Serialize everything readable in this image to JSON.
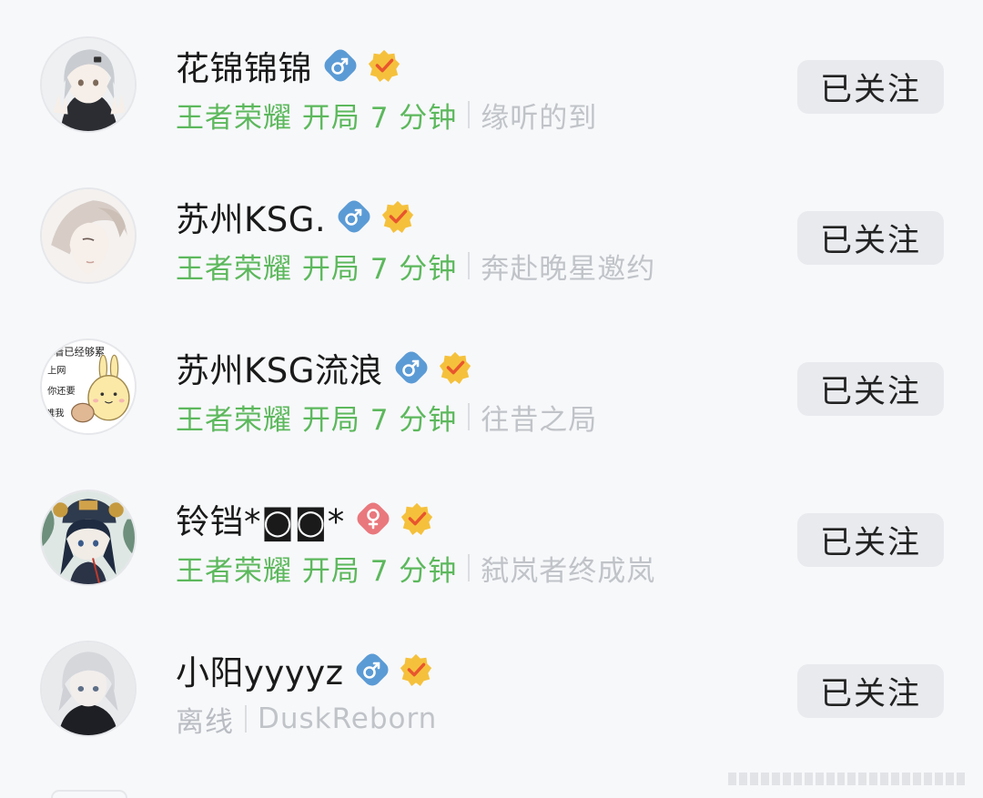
{
  "friends": [
    {
      "name": "花锦锦锦",
      "gender": "male",
      "status": "王者荣耀 开局 7 分钟",
      "status_kind": "in-game",
      "signature": "缘听的到",
      "follow_label": "已关注"
    },
    {
      "name": "苏州KSG.",
      "gender": "male",
      "status": "王者荣耀 开局 7 分钟",
      "status_kind": "in-game",
      "signature": "奔赴晚星邀约",
      "follow_label": "已关注"
    },
    {
      "name": "苏州KSG流浪",
      "gender": "male",
      "status": "王者荣耀 开局 7 分钟",
      "status_kind": "in-game",
      "signature": "往昔之局",
      "follow_label": "已关注"
    },
    {
      "name": "铃铛*◙◙*",
      "gender": "female",
      "status": "王者荣耀 开局 7 分钟",
      "status_kind": "in-game",
      "signature": "弑岚者终成岚",
      "follow_label": "已关注"
    },
    {
      "name": "小阳yyyyz",
      "gender": "male",
      "status": "离线",
      "status_kind": "offline",
      "signature": "DuskReborn",
      "follow_label": "已关注"
    }
  ],
  "avatar_texts": {
    "meme": [
      "看着已经够累",
      "上网",
      "你还要",
      "难我"
    ]
  },
  "colors": {
    "online": "#5cb85c",
    "offline": "#b9bcc2",
    "male": "#5b9bd5",
    "female": "#e9787d",
    "verified": "#f5c13c"
  },
  "icons": {
    "male": "male-symbol-icon",
    "female": "female-symbol-icon",
    "verified": "verified-badge-icon"
  }
}
